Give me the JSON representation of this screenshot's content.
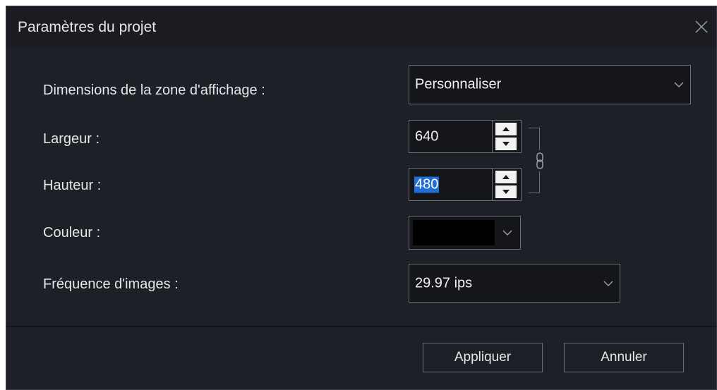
{
  "dialog": {
    "title": "Paramètres du projet",
    "close_icon": "close-icon"
  },
  "fields": {
    "display_area_label": "Dimensions de la zone d'affichage :",
    "display_area_value": "Personnaliser",
    "width_label": "Largeur :",
    "width_value": "640",
    "height_label": "Hauteur :",
    "height_value": "480",
    "color_label": "Couleur :",
    "color_value": "#000000",
    "framerate_label": "Fréquence d'images :",
    "framerate_value": "29.97 ips",
    "link_icon": "chain-link-icon"
  },
  "buttons": {
    "apply_label": "Appliquer",
    "cancel_label": "Annuler"
  },
  "colors": {
    "background": "#1e2027",
    "titlebar": "#1a1c21",
    "selection": "#1f6fd6"
  }
}
